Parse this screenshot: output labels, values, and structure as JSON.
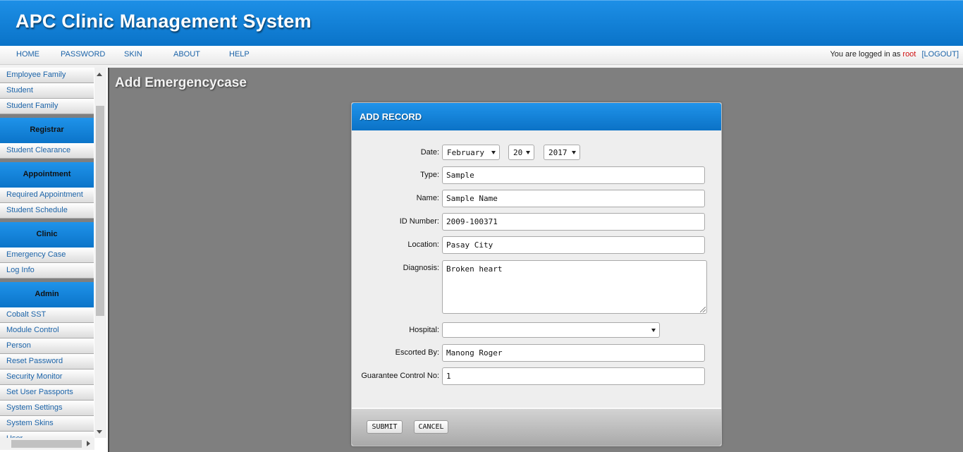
{
  "header": {
    "title": "APC Clinic Management System"
  },
  "nav": {
    "items": [
      "HOME",
      "PASSWORD",
      "SKIN",
      "ABOUT",
      "HELP"
    ],
    "login_prefix": "You are logged in as",
    "user": "root",
    "logout": "[LOGOUT]"
  },
  "sidebar": {
    "items": {
      "employee_family": "Employee Family",
      "student": "Student",
      "student_family": "Student Family",
      "registrar": "Registrar",
      "student_clearance": "Student Clearance",
      "appointment": "Appointment",
      "required_appointment": "Required Appointment",
      "student_schedule": "Student Schedule",
      "clinic": "Clinic",
      "emergency_case": "Emergency Case",
      "log_info": "Log Info",
      "admin": "Admin",
      "cobalt_sst": "Cobalt SST",
      "module_control": "Module Control",
      "person": "Person",
      "reset_password": "Reset Password",
      "security_monitor": "Security Monitor",
      "set_user_passports": "Set User Passports",
      "system_settings": "System Settings",
      "system_skins": "System Skins",
      "user": "User"
    }
  },
  "page": {
    "title": "Add Emergencycase"
  },
  "form": {
    "heading": "ADD RECORD",
    "labels": {
      "date": "Date:",
      "type": "Type:",
      "name": "Name:",
      "id_number": "ID Number:",
      "location": "Location:",
      "diagnosis": "Diagnosis:",
      "hospital": "Hospital:",
      "escorted_by": "Escorted By:",
      "guarantee": "Guarantee Control No:"
    },
    "values": {
      "month": "February",
      "day": "20",
      "year": "2017",
      "type": "Sample",
      "name": "Sample Name",
      "id_number": "2009-100371",
      "location": "Pasay City",
      "diagnosis": "Broken heart",
      "hospital": "",
      "escorted_by": "Manong Roger",
      "guarantee": "1"
    },
    "buttons": {
      "submit": "SUBMIT",
      "cancel": "CANCEL"
    }
  },
  "colors": {
    "header_blue": "#0a73c8",
    "link_blue": "#1b63a8",
    "user_red": "#d01010",
    "content_gray": "#7f7f7f"
  }
}
